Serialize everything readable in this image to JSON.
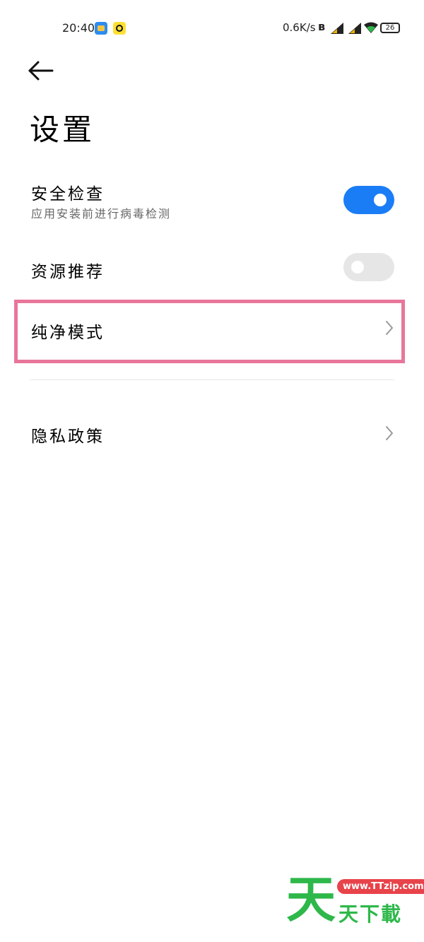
{
  "status_bar": {
    "time": "20:40",
    "net_speed": "0.6K/s",
    "battery": "26",
    "icons": [
      "app-notification-icon",
      "app-notification-icon",
      "bluetooth-icon",
      "signal-icon",
      "signal-icon",
      "wifi-icon",
      "battery-icon"
    ]
  },
  "header": {
    "back_icon": "back-arrow-icon",
    "title": "设置"
  },
  "settings": {
    "items": [
      {
        "label": "安全检查",
        "subtitle": "应用安装前进行病毒检测",
        "control": "toggle",
        "state": "on"
      },
      {
        "label": "资源推荐",
        "control": "toggle",
        "state": "off"
      },
      {
        "label": "纯净模式",
        "control": "chevron",
        "highlighted": true
      },
      {
        "label": "隐私政策",
        "control": "chevron"
      }
    ]
  },
  "watermark": {
    "big_char": "天",
    "url": "www.TTzip.com",
    "text": "天下載"
  },
  "colors": {
    "toggle_on": "#1a7df5",
    "toggle_off": "#e6e6e6",
    "highlight_border": "#e8769a",
    "watermark_green": "#2eb84a",
    "watermark_red": "#e8434a"
  }
}
